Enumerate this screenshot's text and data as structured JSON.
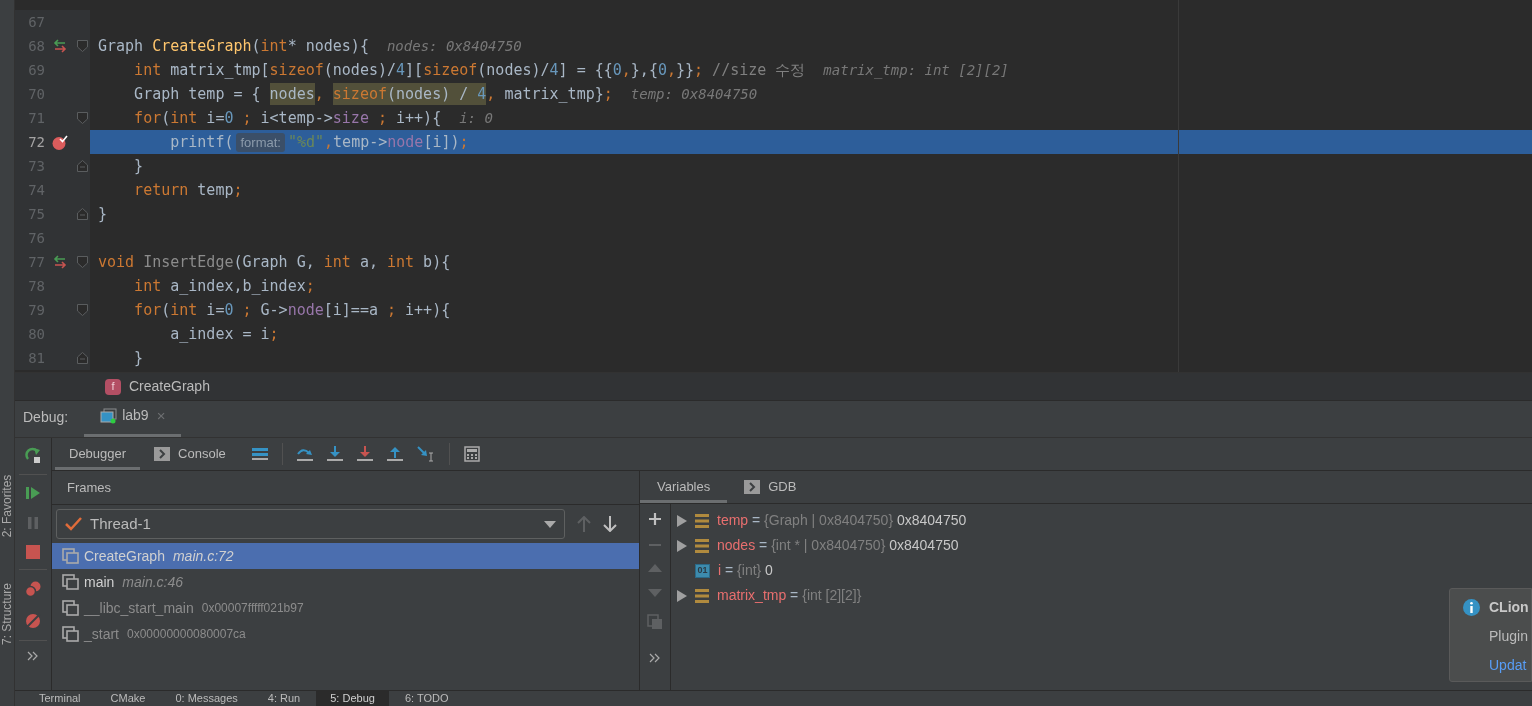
{
  "editor": {
    "lines": [
      {
        "number": "67",
        "current": false
      },
      {
        "number": "68",
        "current": false,
        "gutter": {
          "kind": "override"
        },
        "fold": {
          "kind": "start"
        },
        "segments": [
          {
            "kind": "code",
            "tokens": [
              {
                "kind": "plain",
                "text": "Graph "
              },
              {
                "kind": "function",
                "text": "CreateGraph"
              },
              {
                "kind": "plain",
                "text": "("
              },
              {
                "kind": "keyword",
                "text": "int"
              },
              {
                "kind": "plain",
                "text": "* nodes){"
              }
            ]
          }
        ],
        "hint": "nodes: 0x8404750"
      },
      {
        "number": "69",
        "current": false,
        "segments": [
          {
            "kind": "code",
            "tokens": [
              {
                "kind": "keyword",
                "text": "    int"
              },
              {
                "kind": "plain",
                "text": " matrix_tmp["
              },
              {
                "kind": "keyword",
                "text": "sizeof"
              },
              {
                "kind": "plain",
                "text": "(nodes)/"
              },
              {
                "kind": "number",
                "text": "4"
              },
              {
                "kind": "plain",
                "text": "]["
              },
              {
                "kind": "keyword",
                "text": "sizeof"
              },
              {
                "kind": "plain",
                "text": "(nodes)/"
              },
              {
                "kind": "number",
                "text": "4"
              },
              {
                "kind": "plain",
                "text": "] = {{"
              },
              {
                "kind": "number",
                "text": "0"
              },
              {
                "kind": "keyword",
                "text": ","
              },
              {
                "kind": "plain",
                "text": "},{"
              },
              {
                "kind": "number",
                "text": "0"
              },
              {
                "kind": "keyword",
                "text": ","
              },
              {
                "kind": "plain",
                "text": "}}"
              },
              {
                "kind": "keyword",
                "text": ";"
              },
              {
                "kind": "comment",
                "text": " //size 수정"
              }
            ]
          }
        ],
        "hint": "matrix_tmp: int [2][2]"
      },
      {
        "number": "70",
        "current": false,
        "segments": [
          {
            "kind": "code",
            "tokens": [
              {
                "kind": "plain",
                "text": "    Graph temp = { "
              }
            ]
          },
          {
            "kind": "usage",
            "tokens": [
              {
                "kind": "plain",
                "text": "nodes"
              }
            ]
          },
          {
            "kind": "code",
            "tokens": [
              {
                "kind": "keyword",
                "text": ", "
              }
            ]
          },
          {
            "kind": "usage",
            "tokens": [
              {
                "kind": "keyword",
                "text": "sizeof"
              },
              {
                "kind": "plain",
                "text": "(nodes) / "
              },
              {
                "kind": "number",
                "text": "4"
              }
            ]
          },
          {
            "kind": "code",
            "tokens": [
              {
                "kind": "keyword",
                "text": ", "
              },
              {
                "kind": "plain",
                "text": "matrix_tmp}"
              },
              {
                "kind": "keyword",
                "text": ";"
              }
            ]
          }
        ],
        "hint": "temp: 0x8404750"
      },
      {
        "number": "71",
        "current": false,
        "fold": {
          "kind": "start"
        },
        "segments": [
          {
            "kind": "code",
            "tokens": [
              {
                "kind": "keyword",
                "text": "    for"
              },
              {
                "kind": "plain",
                "text": "("
              },
              {
                "kind": "keyword",
                "text": "int"
              },
              {
                "kind": "plain",
                "text": " i="
              },
              {
                "kind": "number",
                "text": "0"
              },
              {
                "kind": "keyword",
                "text": " ;"
              },
              {
                "kind": "plain",
                "text": " i<temp->"
              },
              {
                "kind": "field",
                "text": "size"
              },
              {
                "kind": "keyword",
                "text": " ;"
              },
              {
                "kind": "plain",
                "text": " i++){"
              }
            ]
          }
        ],
        "hint": "i: 0"
      },
      {
        "number": "72",
        "current": true,
        "gutter": {
          "kind": "breakpoint"
        },
        "segments": [
          {
            "kind": "code",
            "tokens": [
              {
                "kind": "plain",
                "text": "        printf("
              }
            ]
          },
          {
            "kind": "param_hint",
            "text": "format:"
          },
          {
            "kind": "code",
            "tokens": [
              {
                "kind": "string",
                "text": "\"%d\""
              },
              {
                "kind": "keyword",
                "text": ","
              },
              {
                "kind": "plain",
                "text": "temp->"
              },
              {
                "kind": "field",
                "text": "node"
              },
              {
                "kind": "plain",
                "text": "[i])"
              },
              {
                "kind": "keyword",
                "text": ";"
              }
            ]
          }
        ]
      },
      {
        "number": "73",
        "current": false,
        "fold": {
          "kind": "end"
        },
        "segments": [
          {
            "kind": "code",
            "tokens": [
              {
                "kind": "plain",
                "text": "    }"
              }
            ]
          }
        ]
      },
      {
        "number": "74",
        "current": false,
        "segments": [
          {
            "kind": "code",
            "tokens": [
              {
                "kind": "keyword",
                "text": "    return"
              },
              {
                "kind": "plain",
                "text": " temp"
              },
              {
                "kind": "keyword",
                "text": ";"
              }
            ]
          }
        ]
      },
      {
        "number": "75",
        "current": false,
        "fold": {
          "kind": "end"
        },
        "segments": [
          {
            "kind": "code",
            "tokens": [
              {
                "kind": "plain",
                "text": "}"
              }
            ]
          }
        ]
      },
      {
        "number": "76",
        "current": false
      },
      {
        "number": "77",
        "current": false,
        "gutter": {
          "kind": "override"
        },
        "fold": {
          "kind": "start"
        },
        "segments": [
          {
            "kind": "code",
            "tokens": [
              {
                "kind": "keyword",
                "text": "void"
              },
              {
                "kind": "unused",
                "text": " InsertEdge"
              },
              {
                "kind": "plain",
                "text": "(Graph G, "
              },
              {
                "kind": "keyword",
                "text": "int"
              },
              {
                "kind": "plain",
                "text": " a, "
              },
              {
                "kind": "keyword",
                "text": "int"
              },
              {
                "kind": "plain",
                "text": " b){"
              }
            ]
          }
        ]
      },
      {
        "number": "78",
        "current": false,
        "segments": [
          {
            "kind": "code",
            "tokens": [
              {
                "kind": "keyword",
                "text": "    int"
              },
              {
                "kind": "plain",
                "text": " a_index,b_index"
              },
              {
                "kind": "keyword",
                "text": ";"
              }
            ]
          }
        ]
      },
      {
        "number": "79",
        "current": false,
        "fold": {
          "kind": "start"
        },
        "segments": [
          {
            "kind": "code",
            "tokens": [
              {
                "kind": "keyword",
                "text": "    for"
              },
              {
                "kind": "plain",
                "text": "("
              },
              {
                "kind": "keyword",
                "text": "int"
              },
              {
                "kind": "plain",
                "text": " i="
              },
              {
                "kind": "number",
                "text": "0"
              },
              {
                "kind": "keyword",
                "text": " ;"
              },
              {
                "kind": "plain",
                "text": " G->"
              },
              {
                "kind": "field",
                "text": "node"
              },
              {
                "kind": "plain",
                "text": "[i]==a "
              },
              {
                "kind": "keyword",
                "text": ";"
              },
              {
                "kind": "plain",
                "text": " i++){"
              }
            ]
          }
        ]
      },
      {
        "number": "80",
        "current": false,
        "segments": [
          {
            "kind": "code",
            "tokens": [
              {
                "kind": "plain",
                "text": "        a_index = i"
              },
              {
                "kind": "keyword",
                "text": ";"
              }
            ]
          }
        ]
      },
      {
        "number": "81",
        "current": false,
        "fold": {
          "kind": "end"
        },
        "segments": [
          {
            "kind": "code",
            "tokens": [
              {
                "kind": "plain",
                "text": "    }"
              }
            ]
          }
        ]
      }
    ],
    "breadcrumb": {
      "icon_letter": "f",
      "label": "CreateGraph"
    }
  },
  "side_tabs": [
    {
      "label": "2: Favorites"
    },
    {
      "label": "7: Structure"
    }
  ],
  "debug": {
    "title": "Debug:",
    "session_tab": {
      "label": "lab9",
      "close": "×"
    },
    "tabs": [
      {
        "label": "Debugger",
        "selected": true
      },
      {
        "label": "Console",
        "selected": false
      }
    ],
    "frames": {
      "title": "Frames",
      "thread": "Thread-1",
      "items": [
        {
          "name": "CreateGraph",
          "location": "main.c:72",
          "kind": "source",
          "selected": true
        },
        {
          "name": "main",
          "location": "main.c:46",
          "kind": "source",
          "selected": false
        },
        {
          "name": "__libc_start_main",
          "location": "0x00007fffff021b97",
          "kind": "address",
          "selected": false
        },
        {
          "name": "_start",
          "location": "0x00000000080007ca",
          "kind": "address",
          "selected": false
        }
      ]
    },
    "variables_tabs": [
      {
        "label": "Variables",
        "selected": true
      },
      {
        "label": "GDB",
        "selected": false
      }
    ],
    "variables": [
      {
        "name": "temp",
        "operator": "=",
        "type": "{Graph | 0x8404750}",
        "value": "0x8404750",
        "kind": "struct"
      },
      {
        "name": "nodes",
        "operator": "=",
        "type": "{int * | 0x8404750}",
        "value": "0x8404750",
        "kind": "struct"
      },
      {
        "name": "i",
        "operator": "=",
        "type": "{int}",
        "value": "0",
        "kind": "primitive",
        "badge": "01"
      },
      {
        "name": "matrix_tmp",
        "operator": "=",
        "type": "{int [2][2]}",
        "kind": "struct"
      }
    ]
  },
  "notification": {
    "title": "CLion",
    "text": "Plugin",
    "link": "Updat"
  },
  "bottom_tabs": [
    {
      "label": "Terminal",
      "selected": false
    },
    {
      "label": "CMake",
      "selected": false
    },
    {
      "label": "0: Messages",
      "selected": false
    },
    {
      "label": "4: Run",
      "selected": false
    },
    {
      "label": "5: Debug",
      "selected": true
    },
    {
      "label": "6: TODO",
      "selected": false
    }
  ]
}
